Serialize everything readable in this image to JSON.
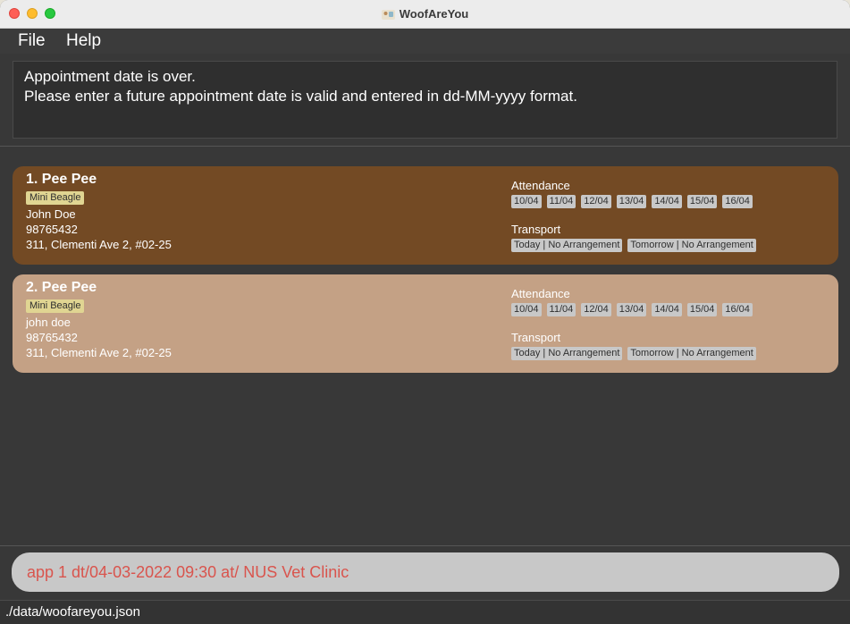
{
  "window": {
    "title": "WoofAreYou"
  },
  "menu": {
    "file": "File",
    "help": "Help"
  },
  "result": {
    "line1": "Appointment date is over.",
    "line2": "Please enter a future appointment date is valid and entered in dd-MM-yyyy format."
  },
  "pets": [
    {
      "index_name": "1.  Pee Pee",
      "breed": "Mini Beagle",
      "owner": "John Doe",
      "phone": "98765432",
      "address": "311, Clementi Ave 2, #02-25",
      "attendance_label": "Attendance",
      "attendance": [
        "10/04",
        "11/04",
        "12/04",
        "13/04",
        "14/04",
        "15/04",
        "16/04"
      ],
      "transport_label": "Transport",
      "transport": [
        "Today | No Arrangement",
        "Tomorrow | No Arrangement"
      ]
    },
    {
      "index_name": "2.  Pee Pee",
      "breed": "Mini Beagle",
      "owner": "john doe",
      "phone": "98765432",
      "address": "311, Clementi Ave 2, #02-25",
      "attendance_label": "Attendance",
      "attendance": [
        "10/04",
        "11/04",
        "12/04",
        "13/04",
        "14/04",
        "15/04",
        "16/04"
      ],
      "transport_label": "Transport",
      "transport": [
        "Today | No Arrangement",
        "Tomorrow | No Arrangement"
      ]
    }
  ],
  "command": {
    "value": "app 1 dt/04-03-2022 09:30 at/ NUS Vet Clinic"
  },
  "status": {
    "path": "./data/woofareyou.json"
  },
  "colors": {
    "card_selected": "#734a24",
    "card_default": "#c4a185",
    "breed_tag": "#e0d592",
    "command_error_text": "#d9544d"
  }
}
